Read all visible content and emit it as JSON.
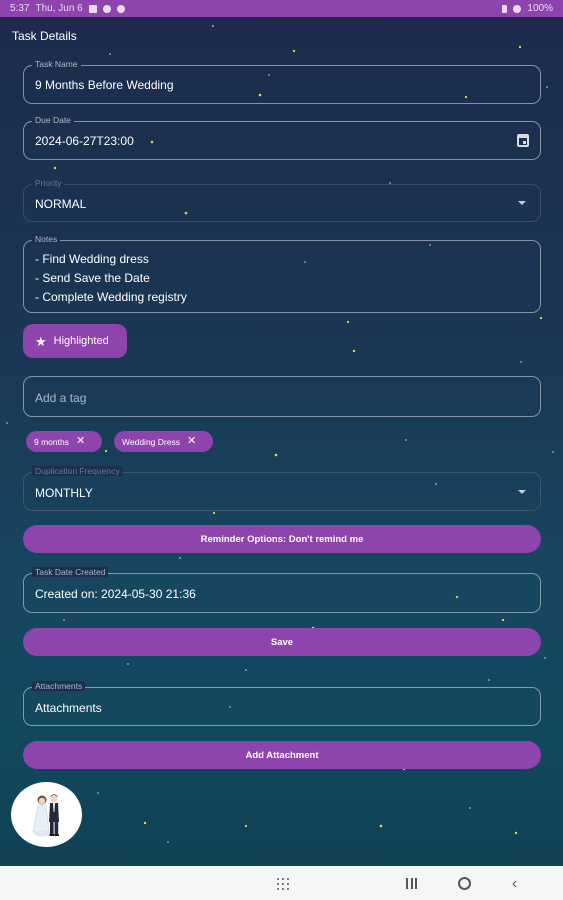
{
  "statusbar": {
    "time": "5:37",
    "date": "Thu, Jun 6",
    "battery": "100%"
  },
  "header": {
    "title": "Task Details"
  },
  "task_name": {
    "label": "Task Name",
    "value": "9 Months Before Wedding"
  },
  "due_date": {
    "label": "Due Date",
    "value": "2024-06-27T23:00"
  },
  "priority": {
    "label": "Priority",
    "value": "NORMAL"
  },
  "notes": {
    "label": "Notes",
    "lines": [
      "- Find Wedding dress",
      "- Send Save the Date",
      "- Complete Wedding registry"
    ]
  },
  "highlight_chip": {
    "label": "Highlighted"
  },
  "tag_input": {
    "placeholder": "Add a tag"
  },
  "tags": [
    "9 months",
    "Wedding Dress"
  ],
  "duplication": {
    "label": "Duplication Frequency",
    "value": "MONTHLY"
  },
  "reminder_button": {
    "label": "Reminder Options: Don't remind me"
  },
  "date_created": {
    "label": "Task Date Created",
    "value": "Created on: 2024-05-30 21:36"
  },
  "save_button": {
    "label": "Save"
  },
  "attachments": {
    "label": "Attachments",
    "value": "Attachments"
  },
  "add_attachment_button": {
    "label": "Add Attachment"
  },
  "colors": {
    "accent": "#8e44ad",
    "background_top": "#1d2b4d",
    "background_bottom": "#0f3f52",
    "navbar": "#f5f5f7"
  },
  "icons": [
    "calendar-icon",
    "dropdown-arrow-icon",
    "star-icon",
    "close-icon",
    "wedding-couple-avatar",
    "nav-apps-icon",
    "nav-recents-icon",
    "nav-home-icon",
    "nav-back-icon"
  ]
}
